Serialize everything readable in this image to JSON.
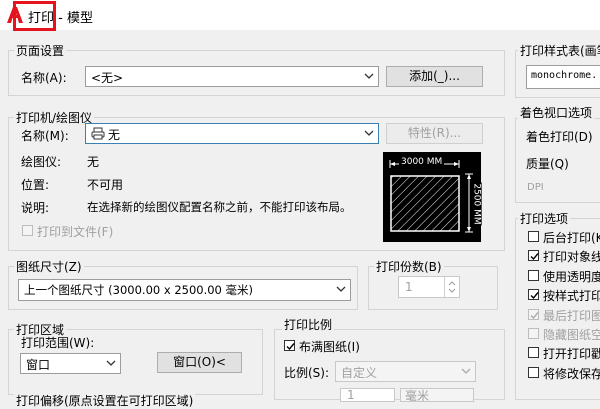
{
  "window": {
    "title_highlight": "打印",
    "title_rest": " - 模型"
  },
  "page_setup": {
    "group_title": "页面设置",
    "name_label": "名称(A):",
    "name_value": "<无>",
    "add_button": "添加(_)..."
  },
  "printer": {
    "group_title": "打印机/绘图仪",
    "name_label": "名称(M):",
    "name_value": "无",
    "properties_button": "特性(R)...",
    "plotter_label": "绘图仪:",
    "plotter_value": "无",
    "location_label": "位置:",
    "location_value": "不可用",
    "desc_label": "说明:",
    "desc_value": "在选择新的绘图仪配置名称之前，不能打印该布局。",
    "print_to_file": "打印到文件(F)",
    "preview_width": "3000 MM",
    "preview_height": "2500 MM"
  },
  "paper": {
    "group_title": "图纸尺寸(Z)",
    "value": "上一个图纸尺寸 (3000.00 x 2500.00 毫米)"
  },
  "copies": {
    "group_title": "打印份数(B)",
    "value": "1"
  },
  "area": {
    "group_title": "打印区域",
    "range_label": "打印范围(W):",
    "range_value": "窗口",
    "window_button": "窗口(O)<"
  },
  "scale": {
    "group_title": "打印比例",
    "fit_label": "布满图纸(I)",
    "fit_checked": true,
    "scale_label": "比例(S):",
    "scale_value": "自定义",
    "unit_value": "1",
    "unit_name": "毫米"
  },
  "offset": {
    "group_title": "打印偏移(原点设置在可打印区域)"
  },
  "style_table": {
    "group_title": "打印样式表(画笔",
    "value": "monochrome."
  },
  "shaded": {
    "group_title": "着色视口选项",
    "shade_label": "着色打印(D)",
    "quality_label": "质量(Q)",
    "dpi_label": "DPI"
  },
  "options": {
    "group_title": "打印选项",
    "items": [
      {
        "label": "后台打印(K",
        "checked": false,
        "disabled": false
      },
      {
        "label": "打印对象线",
        "checked": true,
        "disabled": false
      },
      {
        "label": "使用透明度",
        "checked": false,
        "disabled": false
      },
      {
        "label": "按样式打印",
        "checked": true,
        "disabled": false
      },
      {
        "label": "最后打印图",
        "checked": true,
        "disabled": true
      },
      {
        "label": "隐藏图纸空",
        "checked": false,
        "disabled": true
      },
      {
        "label": "打开打印戳",
        "checked": false,
        "disabled": false
      },
      {
        "label": "将修改保存",
        "checked": false,
        "disabled": false
      }
    ]
  },
  "colors": {
    "highlight": "#e3141e",
    "logo": "#e3141e"
  }
}
